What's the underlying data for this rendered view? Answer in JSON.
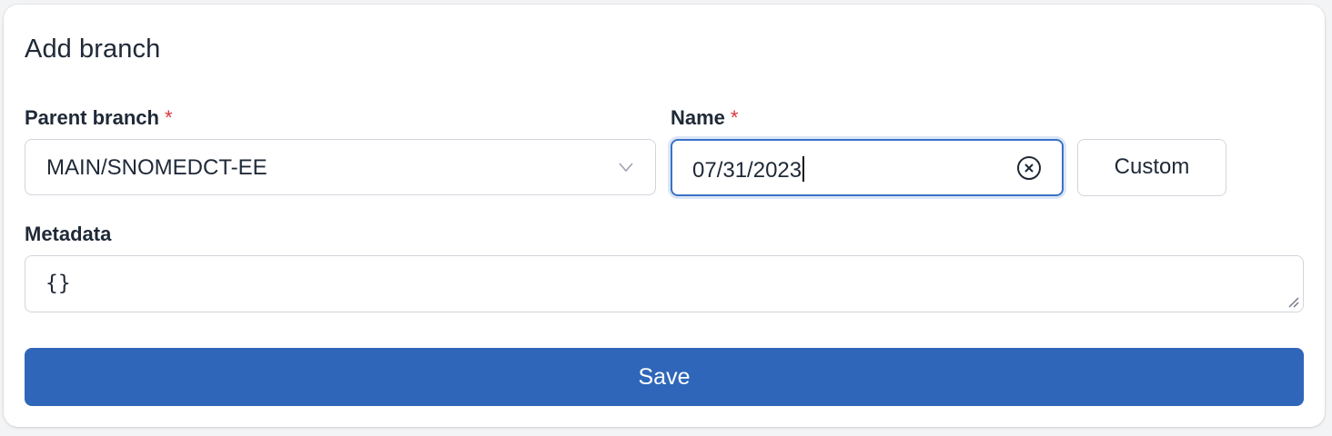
{
  "form": {
    "title": "Add branch",
    "parent_branch": {
      "label": "Parent branch",
      "required_mark": "*",
      "value": "MAIN/SNOMEDCT-EE",
      "icon": "chevron-down-icon"
    },
    "name": {
      "label": "Name",
      "required_mark": "*",
      "value": "07/31/2023",
      "clear_icon": "clear-circle-icon"
    },
    "custom_button_label": "Custom",
    "metadata": {
      "label": "Metadata",
      "value": "{}"
    },
    "save_label": "Save"
  },
  "colors": {
    "primary": "#2f66b9",
    "focus_border": "#3b72c8",
    "required": "#d9363e"
  }
}
